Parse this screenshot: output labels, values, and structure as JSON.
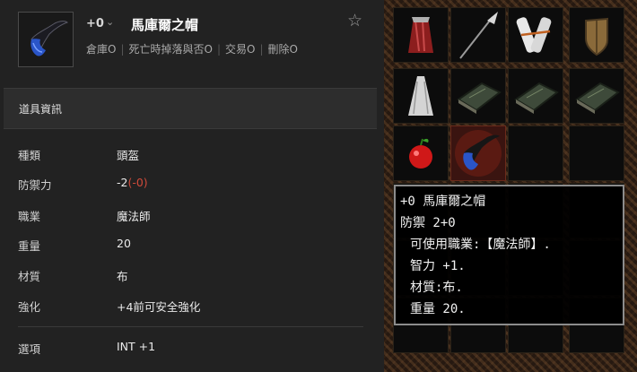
{
  "item": {
    "enhance": "+0",
    "name": "馬庫爾之帽",
    "flags": [
      "倉庫O",
      "死亡時掉落與否O",
      "交易O",
      "刪除O"
    ]
  },
  "section": {
    "title": "道具資訊"
  },
  "info": [
    {
      "label": "種類",
      "value": "頭盔"
    },
    {
      "label": "防禦力",
      "value": "-2",
      "suffix": "(-0)"
    },
    {
      "label": "職業",
      "value": "魔法師"
    },
    {
      "label": "重量",
      "value": "20"
    },
    {
      "label": "材質",
      "value": "布"
    },
    {
      "label": "強化",
      "value": "+4前可安全強化"
    },
    {
      "label": "選項",
      "value": "INT +1"
    }
  ],
  "tooltip": {
    "title": "+0 馬庫爾之帽",
    "defense": "防禦 2+0",
    "class_line": "可使用職業:【魔法師】.",
    "int_line": "智力 +1.",
    "material_line": "材質:布.",
    "weight_line": "重量 20."
  },
  "inventory": [
    {
      "icon": "red-cloak-icon"
    },
    {
      "icon": "spear-icon"
    },
    {
      "icon": "scroll-bundle-icon"
    },
    {
      "icon": "wooden-shield-icon"
    },
    {
      "icon": "white-cloak-icon"
    },
    {
      "icon": "spellbook-icon"
    },
    {
      "icon": "spellbook-icon"
    },
    {
      "icon": "spellbook-icon"
    },
    {
      "icon": "red-apple-icon"
    },
    {
      "icon": "wizard-hat-icon"
    }
  ],
  "colors": {
    "accent_negative": "#d04a3a",
    "panel_bg": "#222222"
  }
}
